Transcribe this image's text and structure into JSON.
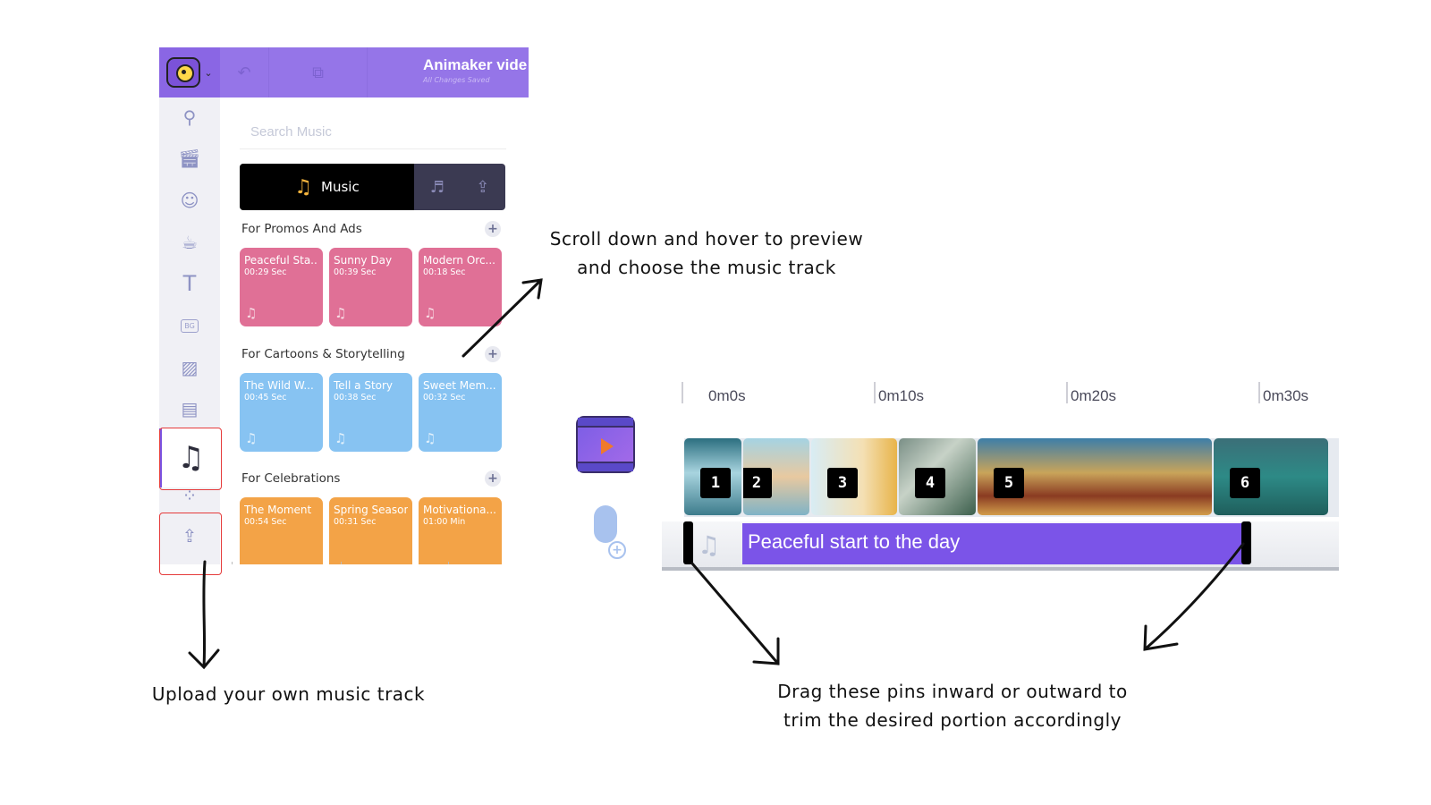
{
  "editor": {
    "title": "Animaker vide",
    "save_status": "All Changes Saved",
    "search_placeholder": "Search Music",
    "tabs": {
      "music_label": "Music",
      "music_icon": "music-note-icon",
      "sfx_icon": "sound-effects-icon",
      "upload_icon": "upload-icon"
    },
    "sidebar_icons": [
      "search-icon",
      "clapperboard-icon",
      "character-icon",
      "props-icon",
      "text-icon",
      "background-icon",
      "image-icon",
      "video-icon",
      "music-icon",
      "effects-icon",
      "upload-icon"
    ],
    "sections": [
      {
        "title": "For Promos And Ads",
        "color": "#e07096",
        "tracks": [
          {
            "title": "Peaceful Sta...",
            "duration": "00:29 Sec"
          },
          {
            "title": "Sunny Day",
            "duration": "00:39 Sec"
          },
          {
            "title": "Modern Orc...",
            "duration": "00:18 Sec"
          }
        ]
      },
      {
        "title": "For Cartoons & Storytelling",
        "color": "#87c3f2",
        "tracks": [
          {
            "title": "The Wild W...",
            "duration": "00:45 Sec"
          },
          {
            "title": "Tell a Story",
            "duration": "00:38 Sec"
          },
          {
            "title": "Sweet Mem...",
            "duration": "00:32 Sec"
          }
        ]
      },
      {
        "title": "For Celebrations",
        "color": "#f3a347",
        "tracks": [
          {
            "title": "The Moment",
            "duration": "00:54 Sec"
          },
          {
            "title": "Spring Season",
            "duration": "00:31 Sec"
          },
          {
            "title": "Motivationa...",
            "duration": "01:00 Min"
          }
        ]
      }
    ],
    "mini_ruler": [
      "0m0s",
      "0m10s",
      "0m20s"
    ]
  },
  "timeline": {
    "ruler": [
      "0m0s",
      "0m10s",
      "0m20s",
      "0m30s"
    ],
    "scenes": [
      "1",
      "2",
      "3",
      "4",
      "5",
      "6"
    ],
    "audio_track_title": "Peaceful start to the day",
    "audio_color": "#7b54e8"
  },
  "annotations": {
    "preview": [
      "Scroll down and hover to preview",
      "and choose the music track"
    ],
    "upload": "Upload your own music track",
    "trim": [
      "Drag these pins inward or outward to",
      "trim the desired portion accordingly"
    ]
  },
  "colors": {
    "accent": "#9575e8",
    "highlight_box": "#e53b3b"
  }
}
